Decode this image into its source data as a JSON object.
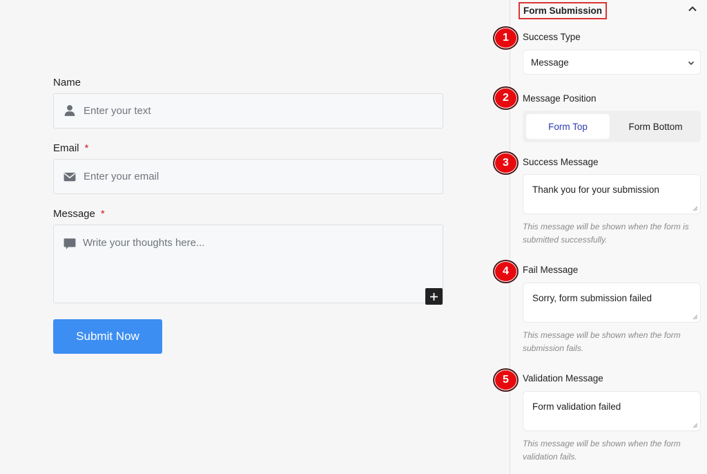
{
  "form": {
    "fields": [
      {
        "label": "Name",
        "required": false,
        "placeholder": "Enter your text",
        "icon": "user-icon"
      },
      {
        "label": "Email",
        "required": true,
        "placeholder": "Enter your email",
        "icon": "envelope-icon"
      },
      {
        "label": "Message",
        "required": true,
        "placeholder": "Write your thoughts here...",
        "icon": "comment-icon"
      }
    ],
    "required_mark": "*",
    "add_button_icon": "plus-icon",
    "submit_label": "Submit Now"
  },
  "panel": {
    "title": "Form Submission",
    "collapse_icon": "chevron-up-icon",
    "success_type": {
      "badge": "1",
      "label": "Success Type",
      "value": "Message"
    },
    "message_position": {
      "badge": "2",
      "label": "Message Position",
      "options": [
        "Form Top",
        "Form Bottom"
      ],
      "selected": "Form Top"
    },
    "success_message": {
      "badge": "3",
      "label": "Success Message",
      "value": "Thank you for your submission",
      "help": "This message will be shown when the form is submitted successfully."
    },
    "fail_message": {
      "badge": "4",
      "label": "Fail Message",
      "value": "Sorry, form submission failed",
      "help": "This message will be shown when the form submission fails."
    },
    "validation_message": {
      "badge": "5",
      "label": "Validation Message",
      "value": "Form validation failed",
      "help": "This message will be shown when the form validation fails."
    }
  },
  "colors": {
    "accent": "#3c8ef3",
    "callout": "#e8090e",
    "highlight_border": "#dd3333",
    "active_tab_text": "#2e3bb0"
  }
}
